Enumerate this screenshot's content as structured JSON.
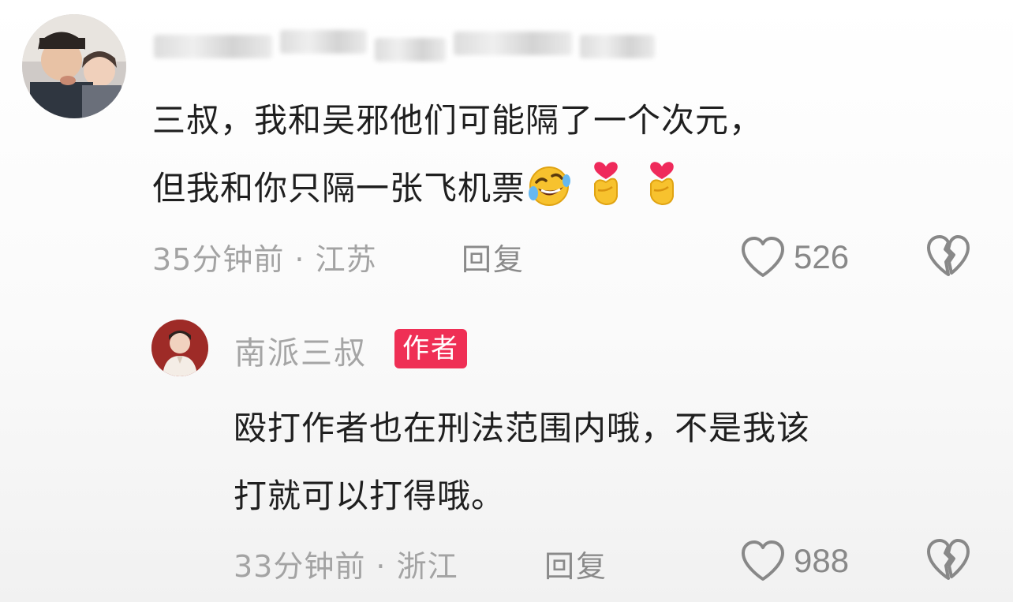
{
  "comments": [
    {
      "username_blurred": true,
      "text_line1": "三叔，我和吴邪他们可能隔了一个次元，",
      "text_line2": "但我和你只隔一张飞机票",
      "emojis": [
        "rolling-laughing-emoji",
        "finger-heart-emoji",
        "finger-heart-emoji"
      ],
      "time_location": "35分钟前 · 江苏",
      "reply_label": "回复",
      "likes": "526"
    },
    {
      "username": "南派三叔",
      "badge": "作者",
      "text_line1": "殴打作者也在刑法范围内哦，不是我该",
      "text_line2": "打就可以打得哦。",
      "time_location": "33分钟前 · 浙江",
      "reply_label": "回复",
      "likes": "988"
    }
  ],
  "colors": {
    "badge": "#ef2f55",
    "text": "#1f1f1f",
    "meta": "#a3a3a3"
  }
}
